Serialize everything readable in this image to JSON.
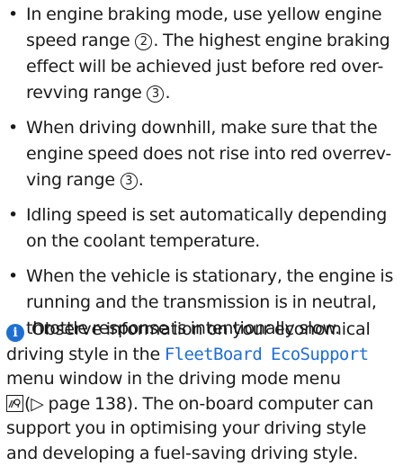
{
  "bullet_char": "•",
  "bullets": [
    {
      "lines": [
        {
          "parts": [
            {
              "t": "In engine braking mode, use yellow engine"
            }
          ]
        },
        {
          "parts": [
            {
              "t": "speed range "
            },
            {
              "circ": "2"
            },
            {
              "t": ". The highest engine braking"
            }
          ]
        },
        {
          "parts": [
            {
              "t": "effect will be achieved just before red over-"
            }
          ]
        },
        {
          "parts": [
            {
              "t": "revving range "
            },
            {
              "circ": "3"
            },
            {
              "t": "."
            }
          ]
        }
      ]
    },
    {
      "lines": [
        {
          "parts": [
            {
              "t": "When driving downhill, make sure that the"
            }
          ]
        },
        {
          "parts": [
            {
              "t": "engine speed does not rise into red overrev-"
            }
          ]
        },
        {
          "parts": [
            {
              "t": "ving range "
            },
            {
              "circ": "3"
            },
            {
              "t": "."
            }
          ]
        }
      ]
    },
    {
      "lines": [
        {
          "parts": [
            {
              "t": "Idling speed is set automatically depending"
            }
          ]
        },
        {
          "parts": [
            {
              "t": "on the coolant temperature."
            }
          ]
        }
      ]
    },
    {
      "lines": [
        {
          "parts": [
            {
              "t": "When the vehicle is stationary, the engine is"
            }
          ]
        },
        {
          "parts": [
            {
              "t": "running and the transmission is in neutral,"
            }
          ]
        },
        {
          "parts": [
            {
              "t": "throttle response is intentionally slow."
            }
          ]
        }
      ]
    }
  ],
  "note": {
    "icon_glyph": "i",
    "icon_name": "info-icon",
    "icon_color": "#1f6fd1",
    "line1": "Observe information on your economical",
    "line2_a": "driving style in the ",
    "line2_b": "FleetBoard EcoSupport",
    "line3": "menu window in the driving mode menu",
    "line4_icon": "steering-wheel-button-icon",
    "line4_a": "(▷ page 138). The on-board computer can",
    "line5": "support you in optimising your driving style",
    "line6": "and developing a fuel-saving driving style."
  }
}
